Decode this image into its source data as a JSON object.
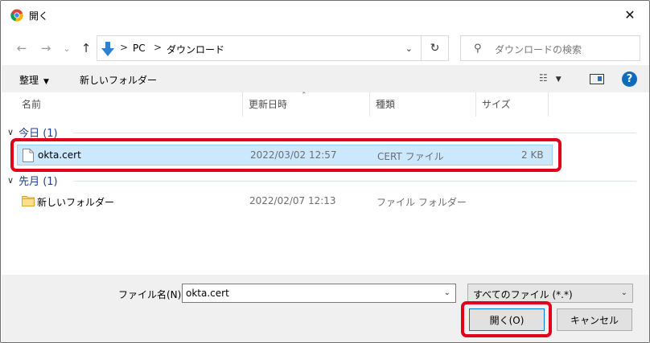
{
  "window": {
    "title": "開く",
    "close_glyph": "✕"
  },
  "nav": {
    "back_glyph": "←",
    "forward_glyph": "→",
    "recent_glyph": "⌄",
    "up_glyph": "↑",
    "breadcrumbs": [
      "PC",
      "ダウンロード"
    ],
    "sep": ">",
    "dropdown_glyph": "⌄",
    "refresh_glyph": "↻",
    "search_icon_glyph": "⚲",
    "search_placeholder": "ダウンロードの検索"
  },
  "toolbar": {
    "organize_label": "整理",
    "caret": "▼",
    "new_folder_label": "新しいフォルダー",
    "view_glyph": "☷",
    "help_glyph": "?"
  },
  "columns": {
    "name": "名前",
    "modified": "更新日時",
    "type": "種類",
    "size": "サイズ",
    "sort_glyph": "⌃"
  },
  "groups": [
    {
      "label": "今日 (1)",
      "chevron": "∨"
    },
    {
      "label": "先月 (1)",
      "chevron": "∨"
    }
  ],
  "files": [
    {
      "name": "okta.cert",
      "modified": "2022/03/02 12:57",
      "type": "CERT ファイル",
      "size": "2 KB",
      "icon": "document-icon"
    },
    {
      "name": "新しいフォルダー",
      "modified": "2022/02/07 12:13",
      "type": "ファイル フォルダー",
      "size": "",
      "icon": "folder-icon"
    }
  ],
  "footer": {
    "filename_label": "ファイル名(N):",
    "filename_value": "okta.cert",
    "filetype_value": "すべてのファイル (*.*)",
    "dd_glyph": "⌄",
    "open_label": "開く(O)",
    "cancel_label": "キャンセル"
  },
  "colors": {
    "accent": "#0078d7",
    "selection": "#cce8ff",
    "highlight": "#e0001b"
  }
}
